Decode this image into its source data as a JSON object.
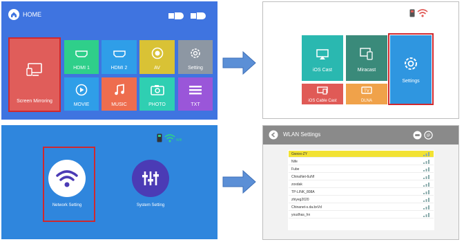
{
  "panel1": {
    "home_label": "HOME",
    "tiles": [
      {
        "label": "Screen Mirroring",
        "color": "#e05d5a"
      },
      {
        "label": "HDMI 1",
        "color": "#2fcf8a"
      },
      {
        "label": "HDMI 2",
        "color": "#2f9ee8"
      },
      {
        "label": "AV",
        "color": "#d9c235"
      },
      {
        "label": "Setting",
        "color": "#8d97a3"
      },
      {
        "label": "MOVIE",
        "color": "#2f9ee8"
      },
      {
        "label": "MUSIC",
        "color": "#ee6d4e"
      },
      {
        "label": "PHOTO",
        "color": "#2fcfb2"
      },
      {
        "label": "TXT",
        "color": "#9a56d9"
      }
    ]
  },
  "panel2": {
    "tiles": [
      {
        "label": "iOS Cast",
        "color": "#2ab8b0"
      },
      {
        "label": "Miracast",
        "color": "#3a8a7a"
      },
      {
        "label": "Settings",
        "color": "#2f96e0"
      },
      {
        "label": "iOS Cable Cast",
        "color": "#e05a56"
      },
      {
        "label": "DLNA",
        "color": "#f0a24a"
      }
    ]
  },
  "panel3": {
    "items": [
      {
        "label": "Network Setting"
      },
      {
        "label": "System Setting"
      }
    ]
  },
  "panel4": {
    "title": "WLAN Settings",
    "networks": [
      "Gwxxx-ZY",
      "Nife",
      "Fube",
      "ChinaNet-6uNf",
      "zoxdak",
      "TP-LINK_808A",
      "zhiyeg2020",
      "Chinanet-s.da.bxVd",
      "youdhas_hn"
    ]
  },
  "colors": {
    "highlight": "#d0282e",
    "arrow": "#5b8fd6",
    "selected_network": "#f2e233"
  }
}
